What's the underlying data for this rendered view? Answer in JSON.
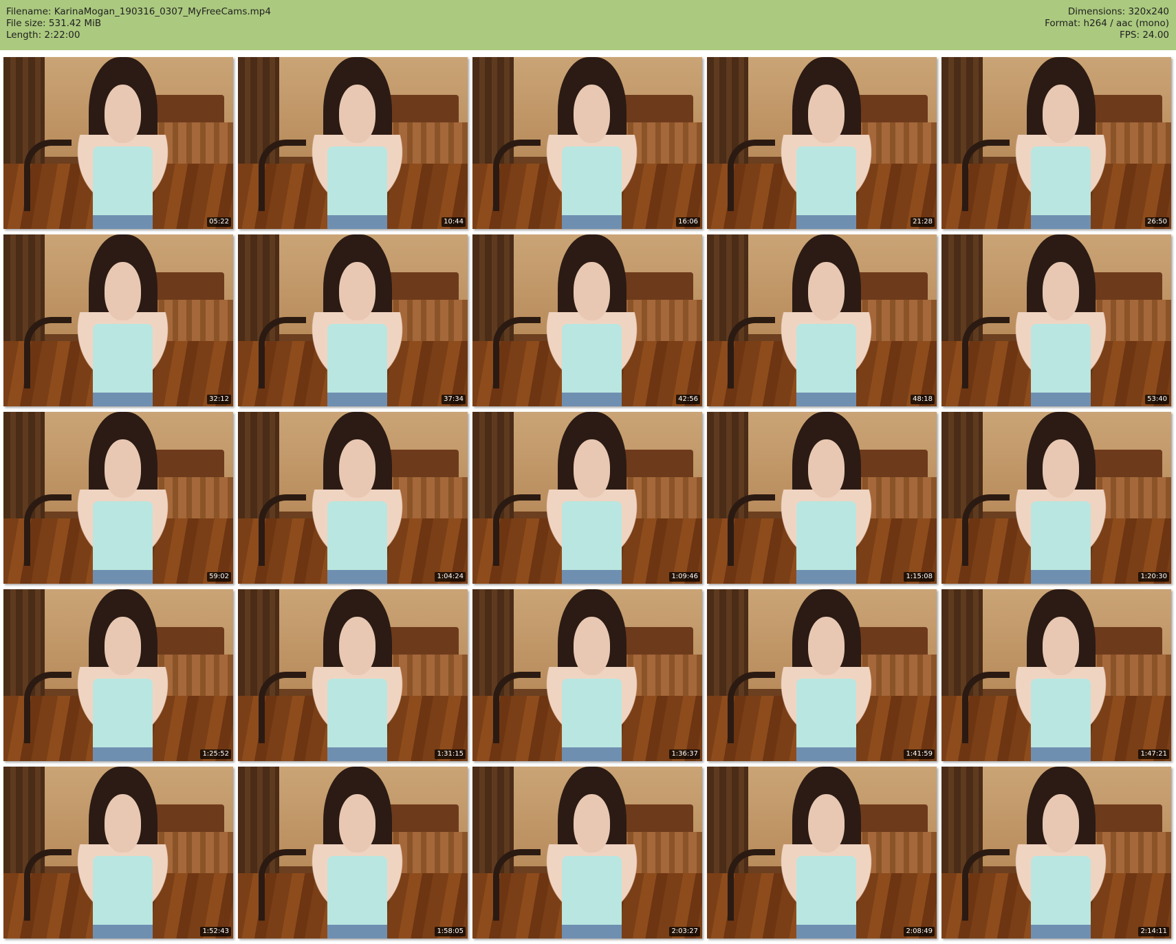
{
  "header": {
    "filename": "Filename: KarinaMogan_190316_0307_MyFreeCams.mp4",
    "file_size": "File size: 531.42 MiB",
    "length": "Length: 2:22:00",
    "dimensions": "Dimensions: 320x240",
    "format": "Format: h264 / aac (mono)",
    "fps": "FPS: 24.00"
  },
  "thumbnails": [
    {
      "time": "05:22"
    },
    {
      "time": "10:44"
    },
    {
      "time": "16:06"
    },
    {
      "time": "21:28"
    },
    {
      "time": "26:50"
    },
    {
      "time": "32:12"
    },
    {
      "time": "37:34"
    },
    {
      "time": "42:56"
    },
    {
      "time": "48:18"
    },
    {
      "time": "53:40"
    },
    {
      "time": "59:02"
    },
    {
      "time": "1:04:24"
    },
    {
      "time": "1:09:46"
    },
    {
      "time": "1:15:08"
    },
    {
      "time": "1:20:30"
    },
    {
      "time": "1:25:52"
    },
    {
      "time": "1:31:15"
    },
    {
      "time": "1:36:37"
    },
    {
      "time": "1:41:59"
    },
    {
      "time": "1:47:21"
    },
    {
      "time": "1:52:43"
    },
    {
      "time": "1:58:05"
    },
    {
      "time": "2:03:27"
    },
    {
      "time": "2:08:49"
    },
    {
      "time": "2:14:11"
    }
  ]
}
